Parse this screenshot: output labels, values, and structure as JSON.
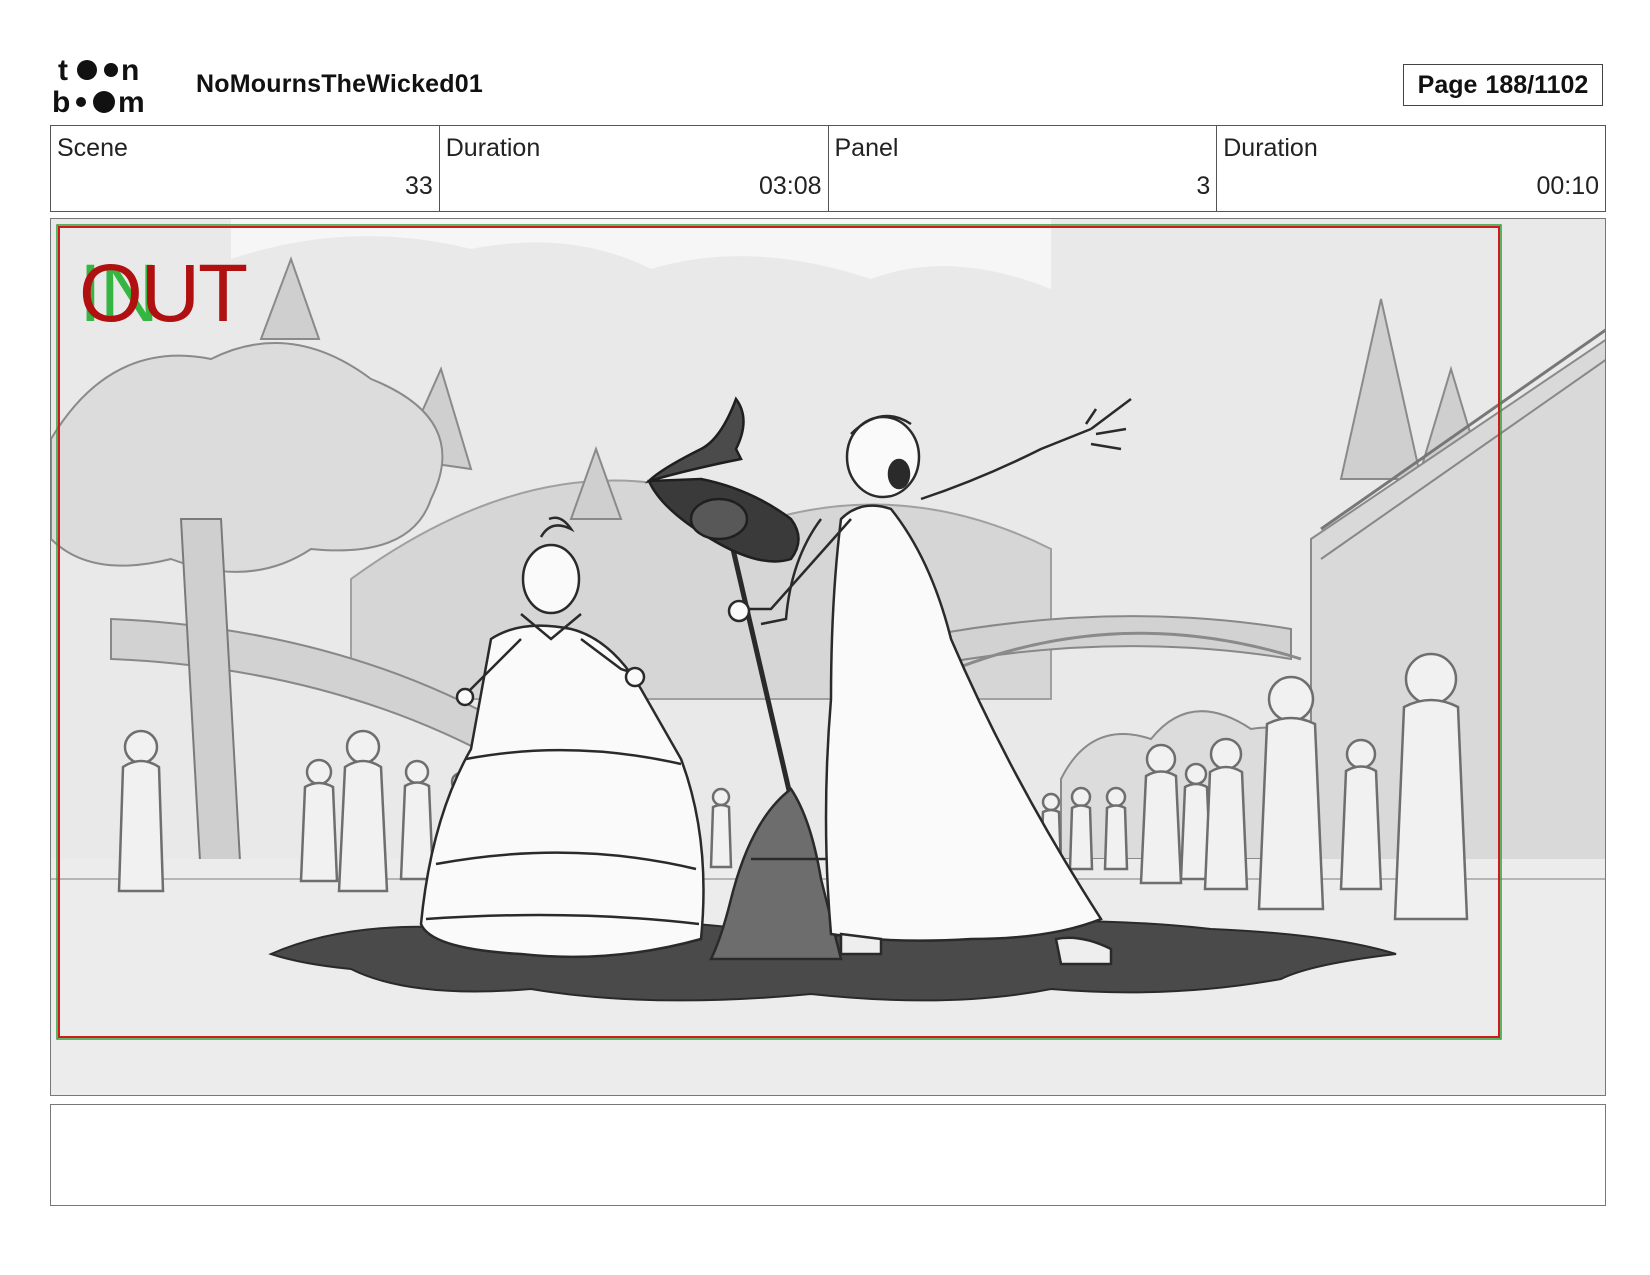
{
  "header": {
    "logo_text": "toon boom",
    "project_title": "NoMournsTheWicked01",
    "page_label": "Page",
    "page_value": "188/1102"
  },
  "info": {
    "scene_label": "Scene",
    "scene_value": "33",
    "scene_duration_label": "Duration",
    "scene_duration_value": "03:08",
    "panel_label": "Panel",
    "panel_value": "3",
    "panel_duration_label": "Duration",
    "panel_duration_value": "00:10"
  },
  "panel_overlay": {
    "in_label": "IN",
    "out_label": "OUT",
    "in_color": "#22b030",
    "out_color": "#b01010"
  },
  "notes": {
    "text": ""
  }
}
